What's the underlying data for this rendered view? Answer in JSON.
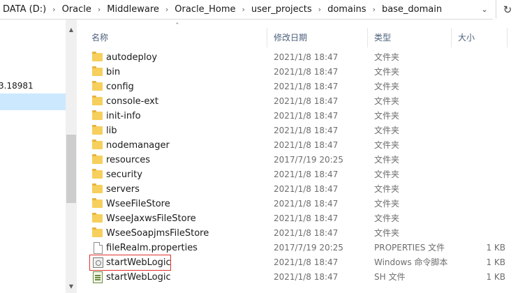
{
  "address": {
    "crumbs": [
      "DATA (D:)",
      "Oracle",
      "Middleware",
      "Oracle_Home",
      "user_projects",
      "domains",
      "base_domain"
    ],
    "dropdown_icon": "chevron-down-icon",
    "refresh_icon": "refresh-icon"
  },
  "nav": {
    "partial_text": "3.18981"
  },
  "columns": {
    "name": "名称",
    "date": "修改日期",
    "type": "类型",
    "size": "大小"
  },
  "files": [
    {
      "name": "autodeploy",
      "date": "2021/1/8 18:47",
      "type": "文件夹",
      "size": "",
      "icon": "folder-icon"
    },
    {
      "name": "bin",
      "date": "2021/1/8 18:47",
      "type": "文件夹",
      "size": "",
      "icon": "folder-icon"
    },
    {
      "name": "config",
      "date": "2021/1/8 18:47",
      "type": "文件夹",
      "size": "",
      "icon": "folder-icon"
    },
    {
      "name": "console-ext",
      "date": "2021/1/8 18:47",
      "type": "文件夹",
      "size": "",
      "icon": "folder-icon"
    },
    {
      "name": "init-info",
      "date": "2021/1/8 18:47",
      "type": "文件夹",
      "size": "",
      "icon": "folder-icon"
    },
    {
      "name": "lib",
      "date": "2021/1/8 18:47",
      "type": "文件夹",
      "size": "",
      "icon": "folder-icon"
    },
    {
      "name": "nodemanager",
      "date": "2021/1/8 18:47",
      "type": "文件夹",
      "size": "",
      "icon": "folder-icon"
    },
    {
      "name": "resources",
      "date": "2017/7/19 20:25",
      "type": "文件夹",
      "size": "",
      "icon": "folder-icon"
    },
    {
      "name": "security",
      "date": "2021/1/8 18:47",
      "type": "文件夹",
      "size": "",
      "icon": "folder-icon"
    },
    {
      "name": "servers",
      "date": "2021/1/8 18:47",
      "type": "文件夹",
      "size": "",
      "icon": "folder-icon"
    },
    {
      "name": "WseeFileStore",
      "date": "2021/1/8 18:47",
      "type": "文件夹",
      "size": "",
      "icon": "folder-icon"
    },
    {
      "name": "WseeJaxwsFileStore",
      "date": "2021/1/8 18:47",
      "type": "文件夹",
      "size": "",
      "icon": "folder-icon"
    },
    {
      "name": "WseeSoapjmsFileStore",
      "date": "2021/1/8 18:47",
      "type": "文件夹",
      "size": "",
      "icon": "folder-icon"
    },
    {
      "name": "fileRealm.properties",
      "date": "2017/7/19 20:25",
      "type": "PROPERTIES 文件",
      "size": "1 KB",
      "icon": "document-icon"
    },
    {
      "name": "startWebLogic",
      "date": "2021/1/8 18:47",
      "type": "Windows 命令脚本",
      "size": "1 KB",
      "icon": "cmd-script-icon"
    },
    {
      "name": "startWebLogic",
      "date": "2021/1/8 18:47",
      "type": "SH 文件",
      "size": "1 KB",
      "icon": "sh-script-icon"
    }
  ],
  "highlight_color": "#e0302c",
  "selection_color": "#cce8ff"
}
